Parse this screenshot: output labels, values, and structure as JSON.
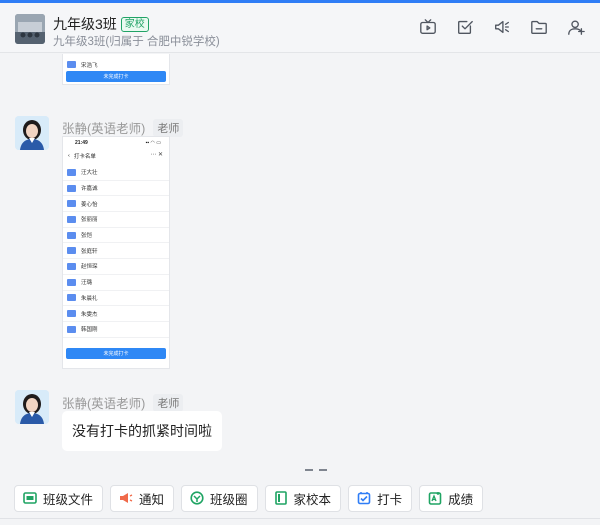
{
  "header": {
    "group_name": "九年级3班",
    "tag": "家校",
    "subtitle": "九年级3班(归属于 合肥中锐学校)",
    "icons": [
      "tv-icon",
      "checkbox-icon",
      "announcement-icon",
      "folder-icon",
      "add-member-icon"
    ]
  },
  "top_card": {
    "last_row_name": "宋浩飞",
    "button_label": "未完成打卡"
  },
  "msg1": {
    "sender": "张静(英语老师)",
    "role": "老师",
    "phone": {
      "time": "21:49",
      "nav_title": "打卡名单",
      "nav_right": "⋯  ✕",
      "rows": [
        "汪大壮",
        "许嘉诚",
        "姜心怡",
        "张丽丽",
        "张恺",
        "张庭轩",
        "赵恒琛",
        "汪璐",
        "朱晨礼",
        "朱雯杰",
        "韩国刚"
      ],
      "button_label": "未完成打卡"
    }
  },
  "msg2": {
    "sender": "张静(英语老师)",
    "role": "老师",
    "text": "没有打卡的抓紧时间啦"
  },
  "toolbar": {
    "items": [
      {
        "label": "班级文件",
        "icon": "class-file-icon",
        "color": "#1fa463"
      },
      {
        "label": "通知",
        "icon": "notice-icon",
        "color": "#f06a4a"
      },
      {
        "label": "班级圈",
        "icon": "class-circle-icon",
        "color": "#1fa463"
      },
      {
        "label": "家校本",
        "icon": "home-school-book-icon",
        "color": "#1fa463"
      },
      {
        "label": "打卡",
        "icon": "check-in-icon",
        "color": "#2f7df6"
      },
      {
        "label": "成绩",
        "icon": "grades-icon",
        "color": "#1fa463"
      }
    ]
  }
}
